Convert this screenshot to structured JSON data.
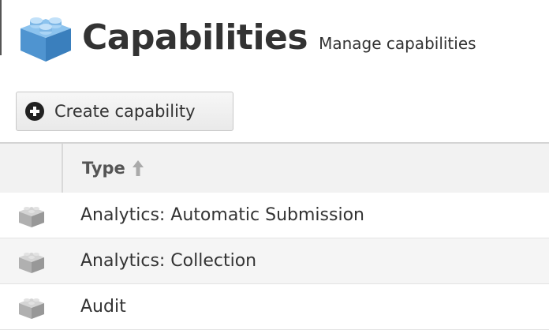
{
  "header": {
    "title": "Capabilities",
    "subtitle": "Manage capabilities",
    "icon": "capability-brick-icon"
  },
  "toolbar": {
    "create_label": "Create capability",
    "create_icon": "plus-circle-icon"
  },
  "table": {
    "columns": [
      {
        "label": "Type",
        "sort": "ascending",
        "sort_icon": "arrow-up-icon"
      }
    ],
    "rows": [
      {
        "type": "Analytics: Automatic Submission",
        "icon": "capability-brick-icon"
      },
      {
        "type": "Analytics: Collection",
        "icon": "capability-brick-icon"
      },
      {
        "type": "Audit",
        "icon": "capability-brick-icon"
      }
    ]
  },
  "colors": {
    "brick_blue": "#5aa0d8",
    "brick_gray": "#b5b5b5",
    "header_bg": "#f2f2f2",
    "row_alt_bg": "#f5f5f5"
  }
}
